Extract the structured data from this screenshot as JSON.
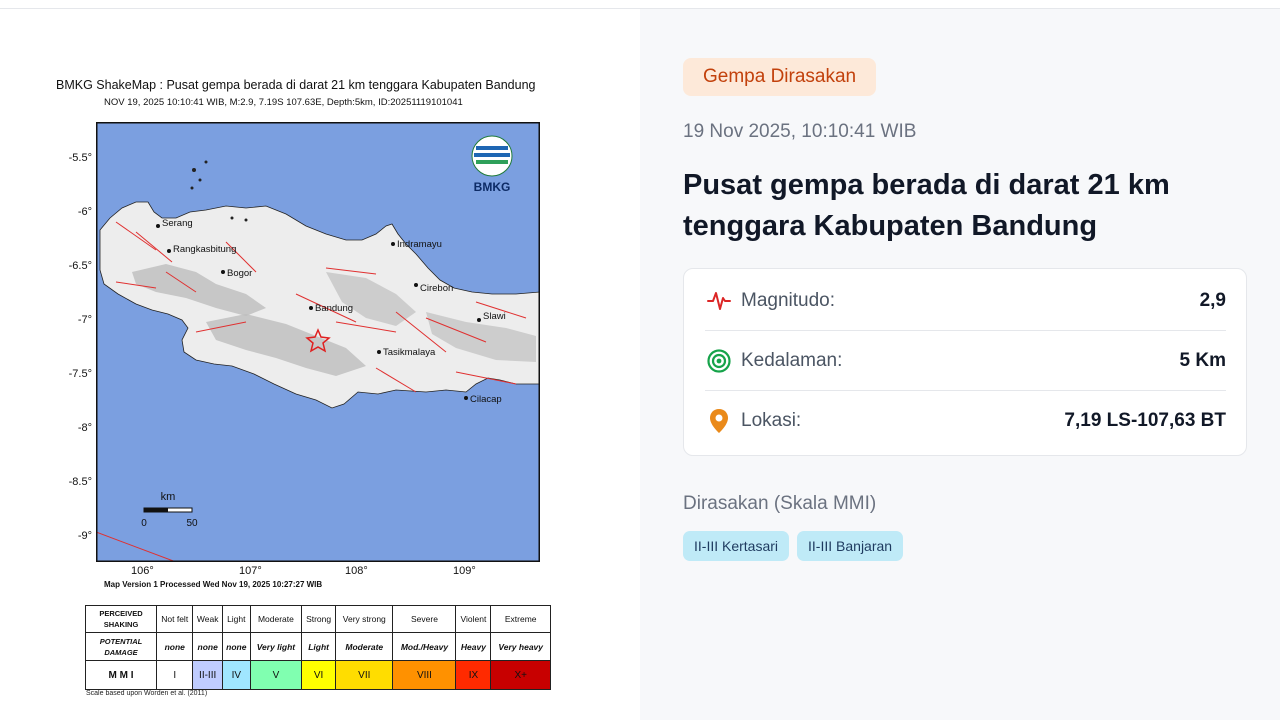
{
  "map": {
    "title": "BMKG ShakeMap : Pusat gempa berada di darat 21 km tenggara Kabupaten Bandung",
    "subtitle": "NOV 19, 2025 10:10:41 WIB, M:2.9, 7.19S 107.63E, Depth:5km, ID:20251119101041",
    "logo_text": "BMKG",
    "lat_labels": [
      "-5.5°",
      "-6°",
      "-6.5°",
      "-7°",
      "-7.5°",
      "-8°",
      "-8.5°",
      "-9°"
    ],
    "lon_labels": [
      "106°",
      "107°",
      "108°",
      "109°"
    ],
    "scale_unit": "km",
    "scale_ticks": [
      "0",
      "50"
    ],
    "cities": [
      "Serang",
      "Rangkasbitung",
      "Indramayu",
      "Bogor",
      "Cirebon",
      "Bandung",
      "Slawi",
      "Tasikmalaya",
      "Cilacap"
    ],
    "version_text": "Map Version 1 Processed Wed Nov 19, 2025 10:27:27 WIB",
    "scale_note": "Scale based upon Worden et al. (2011)",
    "legend": {
      "row_headers": [
        "PERCEIVED SHAKING",
        "POTENTIAL DAMAGE",
        "M M I"
      ],
      "shaking": [
        "Not felt",
        "Weak",
        "Light",
        "Moderate",
        "Strong",
        "Very strong",
        "Severe",
        "Violent",
        "Extreme"
      ],
      "damage": [
        "none",
        "none",
        "none",
        "Very light",
        "Light",
        "Moderate",
        "Mod./Heavy",
        "Heavy",
        "Very heavy"
      ],
      "mmi": [
        "I",
        "II-III",
        "IV",
        "V",
        "VI",
        "VII",
        "VIII",
        "IX",
        "X+"
      ],
      "colors": [
        "#ffffff",
        "#bfccff",
        "#a0e6ff",
        "#80ffb0",
        "#ffff00",
        "#ffdd00",
        "#ff9100",
        "#ff2a00",
        "#c80000"
      ]
    }
  },
  "panel": {
    "badge": "Gempa Dirasakan",
    "datetime": "19 Nov 2025, 10:10:41 WIB",
    "headline": "Pusat gempa berada di darat 21 km tenggara Kabupaten Bandung",
    "magnitude": {
      "icon": "pulse-icon",
      "label": "Magnitudo:",
      "value": "2,9"
    },
    "depth": {
      "icon": "target-icon",
      "label": "Kedalaman:",
      "value": "5 Km"
    },
    "location": {
      "icon": "location-pin-icon",
      "label": "Lokasi:",
      "value": "7,19 LS-107,63 BT"
    },
    "felt_title": "Dirasakan (Skala MMI)",
    "felt_areas": [
      "II-III Kertasari",
      "II-III Banjaran"
    ],
    "colors": {
      "badge_bg": "#fde9d9",
      "badge_text": "#c2410c",
      "chip_bg": "#bfeaf7",
      "pulse": "#dc2626",
      "target": "#16a34a",
      "pin": "#ea8a1a"
    }
  }
}
